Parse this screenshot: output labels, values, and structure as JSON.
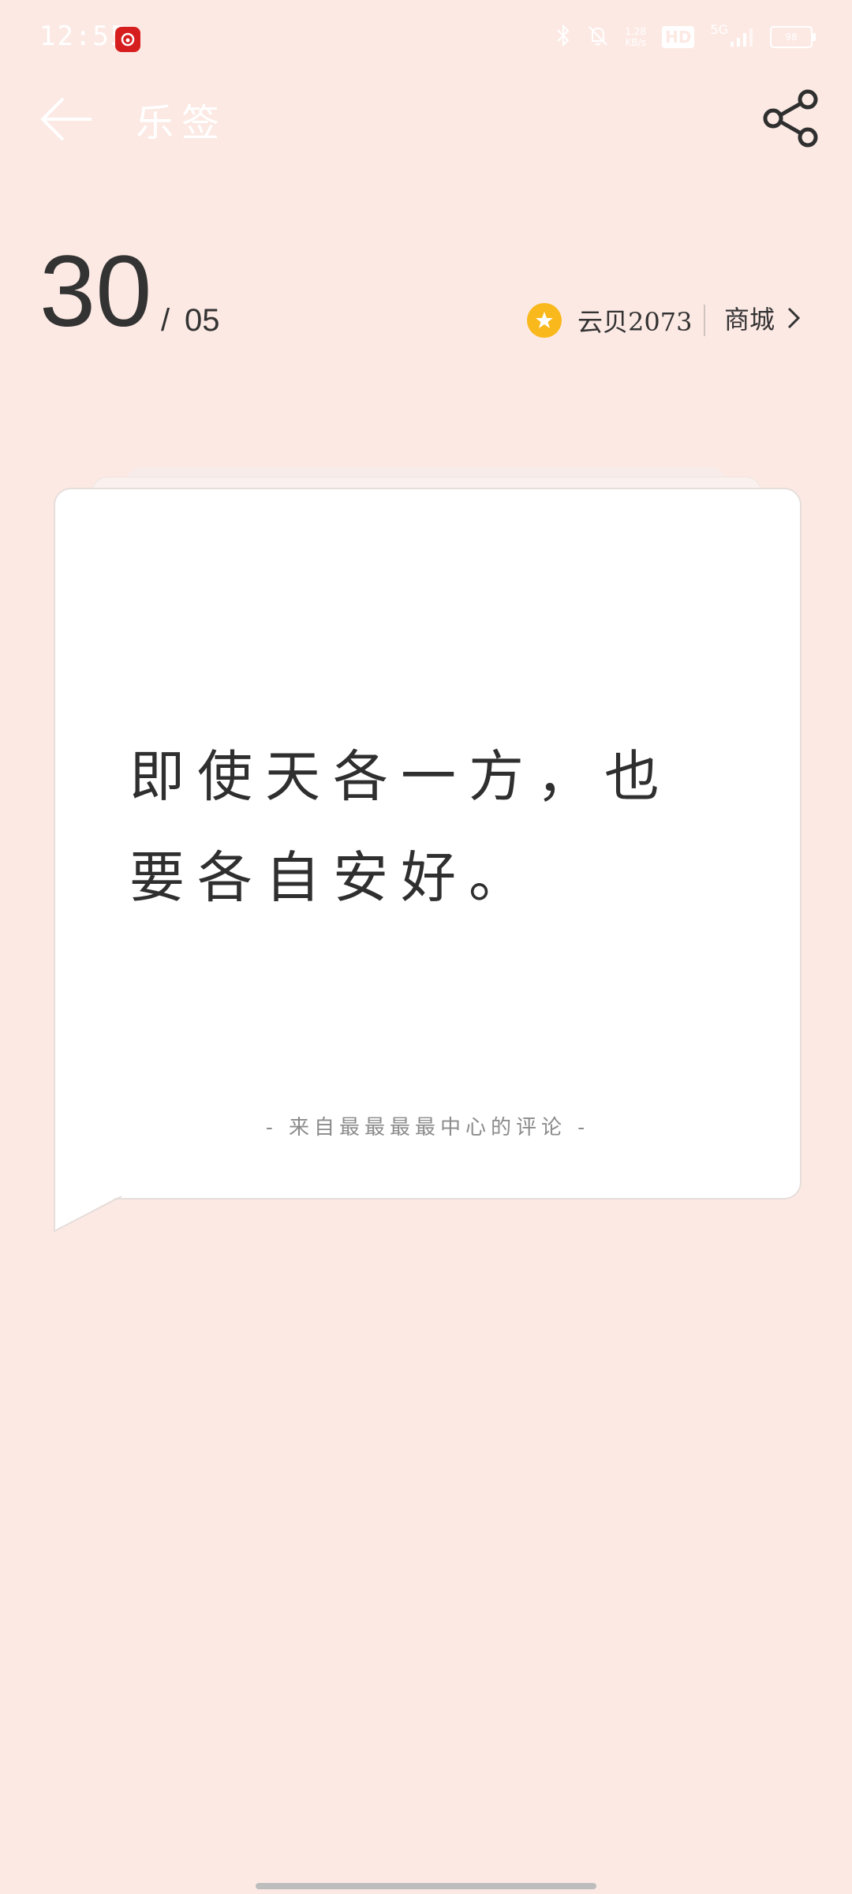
{
  "status_bar": {
    "time": "12:55",
    "net_speed_value": "1.28",
    "net_speed_unit": "KB/s",
    "hd": "HD",
    "signal": "5G",
    "battery_level": "98"
  },
  "app_bar": {
    "title": "乐签",
    "back_icon": "back-arrow-icon",
    "share_icon": "share-icon"
  },
  "date": {
    "day": "30",
    "separator": "/",
    "month": "05"
  },
  "yunbei": {
    "label": "云贝2073",
    "icon": "star-coin-icon"
  },
  "shop": {
    "label": "商城"
  },
  "card": {
    "quote": "即使天各一方，也要各自安好。",
    "source": "- 来自最最最最中心的评论 -"
  },
  "colors": {
    "background": "#fce9e4",
    "card": "#ffffff",
    "coin": "#f9b81b",
    "notification_icon": "#d71e1e"
  }
}
